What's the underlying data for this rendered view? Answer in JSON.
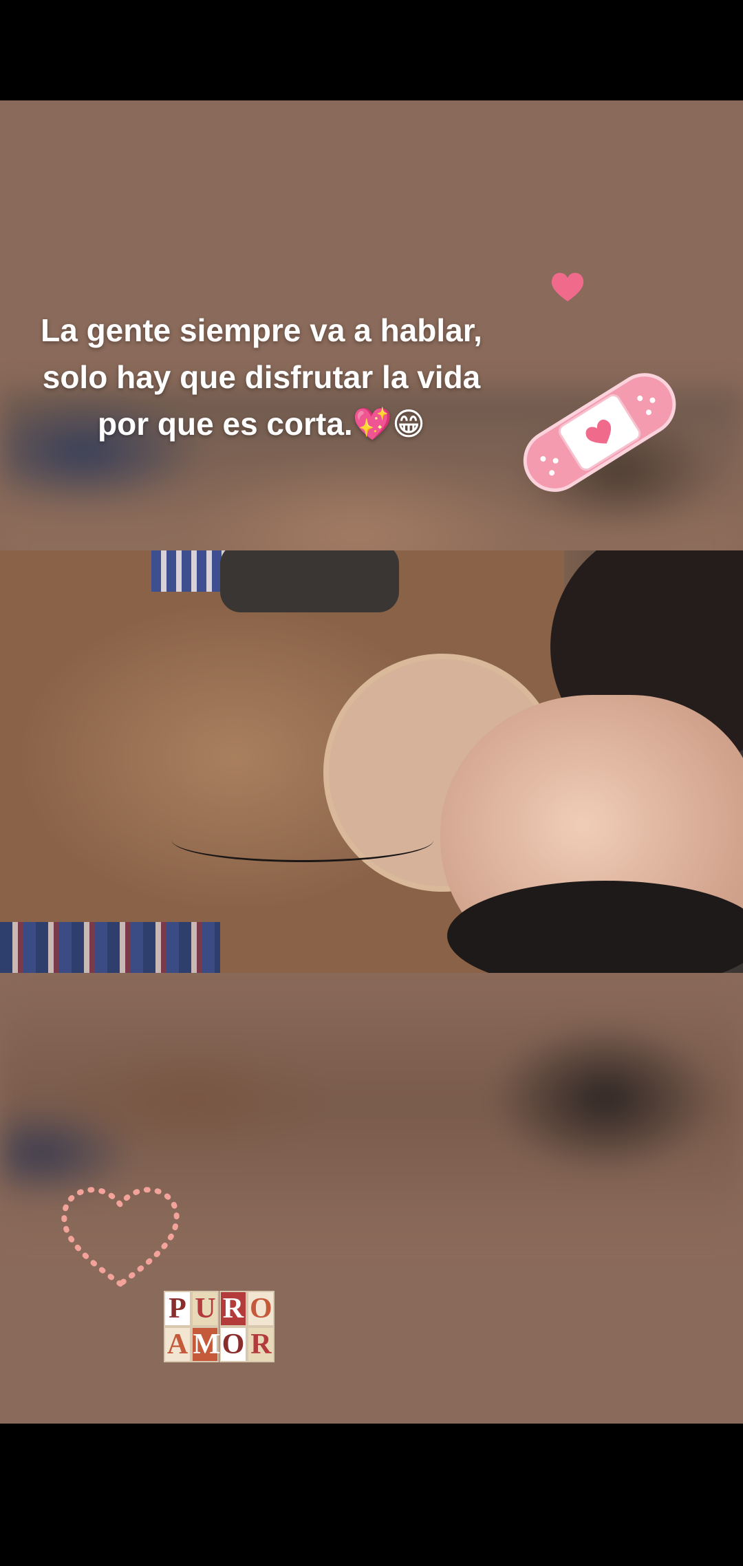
{
  "caption": {
    "line1": "La gente siempre va a hablar,",
    "line2": "solo hay que disfrutar la vida",
    "line3_text": "por que es corta.",
    "line3_emoji": "💖😁"
  },
  "sticker_text": {
    "word1": [
      "P",
      "U",
      "R",
      "O"
    ],
    "word2": [
      "A",
      "M",
      "O",
      "R"
    ]
  },
  "colors": {
    "background": "#8a6a5a",
    "bandage_pink": "#f49bb0",
    "heart_pink": "#f06a8c"
  },
  "icons": [
    "bandage-heart-icon",
    "small-heart-icon",
    "dotted-heart-icon"
  ]
}
